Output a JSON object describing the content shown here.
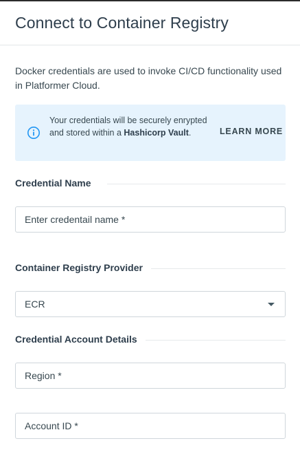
{
  "dialog": {
    "title": "Connect to Container Registry",
    "description": "Docker credentials are used to invoke CI/CD functionality used in Platformer Cloud."
  },
  "info_banner": {
    "text_prefix": "Your credentials will be securely enrypted and stored within a ",
    "text_bold": "Hashicorp Vault",
    "text_suffix": ".",
    "learn_more_label": "LEARN MORE",
    "accent_color": "#2196f3",
    "background_color": "#e6f3fd"
  },
  "sections": {
    "credential_name": {
      "label": "Credential Name",
      "placeholder": "Enter credentail name *"
    },
    "provider": {
      "label": "Container Registry Provider",
      "selected": "ECR"
    },
    "account_details": {
      "label": "Credential Account Details",
      "region_placeholder": "Region *",
      "account_id_placeholder": "Account ID *"
    }
  }
}
